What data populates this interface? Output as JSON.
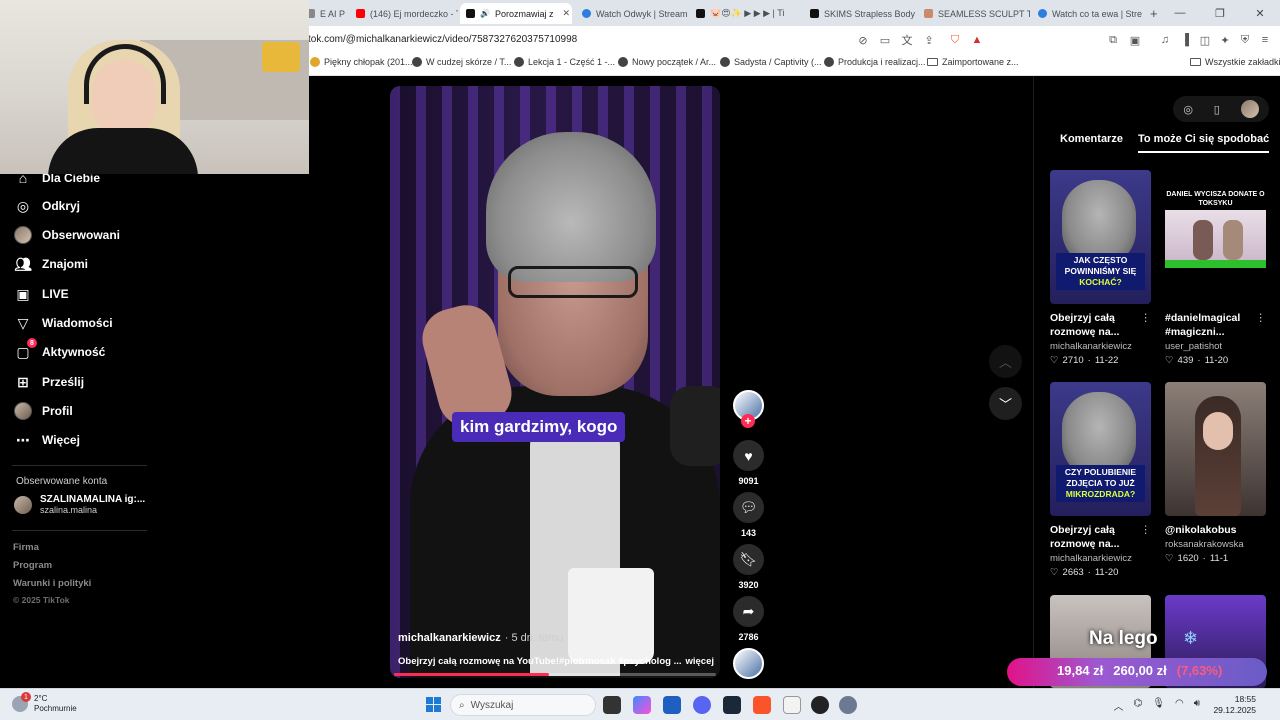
{
  "browser": {
    "tabs": [
      {
        "label": "E AI P",
        "favicon_color": "#888888"
      },
      {
        "label": "(146) Ej mordeczko - T",
        "favicon_color": "#ff0000"
      },
      {
        "label": "Porozmawiaj z",
        "favicon_color": "#111111",
        "active": true
      },
      {
        "label": "Watch Odwyk | Stream",
        "favicon_color": "#2f7de1"
      },
      {
        "label": "🐷😍✨ ▶ ▶ ▶ | Ti",
        "favicon_color": "#111111"
      },
      {
        "label": "SKIMS Strapless Body",
        "favicon_color": "#111111"
      },
      {
        "label": "SEAMLESS SCULPT TH",
        "favicon_color": "#c98b6b"
      },
      {
        "label": "Watch co ta ewa | Stre",
        "favicon_color": "#2f7de1"
      }
    ],
    "new_tab": "+",
    "url": "tok.com/@michalkanarkiewicz/video/7587327620375710998",
    "bookmarks": [
      "Piękny chłopak (201...",
      "W cudzej skórze / T...",
      "Lekcja 1 - Część 1 -...",
      "Nowy początek / Ar...",
      "Sadysta / Captivity (...",
      "Produkcja i realizacj...",
      "Zaimportowane z..."
    ],
    "all_bookmarks": "Wszystkie zakładki"
  },
  "sidebar": {
    "items": [
      {
        "label": "Dla Ciebie",
        "icon": "home-icon"
      },
      {
        "label": "Odkryj",
        "icon": "compass-icon"
      },
      {
        "label": "Obserwowani",
        "icon": "avatar-icon"
      },
      {
        "label": "Znajomi",
        "icon": "friends-icon"
      },
      {
        "label": "LIVE",
        "icon": "live-icon"
      },
      {
        "label": "Wiadomości",
        "icon": "send-icon"
      },
      {
        "label": "Aktywność",
        "icon": "activity-icon",
        "badge": "8"
      },
      {
        "label": "Prześlij",
        "icon": "upload-icon"
      },
      {
        "label": "Profil",
        "icon": "profile-icon"
      },
      {
        "label": "Więcej",
        "icon": "more-icon"
      }
    ],
    "followed_title": "Obserwowane konta",
    "followed": {
      "name": "SZALINAMALINA ig:...",
      "user": "szalina.malina"
    },
    "footer": [
      "Firma",
      "Program",
      "Warunki i polityki"
    ],
    "copyright": "© 2025 TikTok"
  },
  "video": {
    "caption": "kim gardzimy, kogo",
    "author": "michalkanarkiewicz",
    "age": "· 5 dn. temu",
    "description": "Obejrzyj całą rozmowę na YouTube!#piotrmosak #psycholog ...",
    "more": "więcej",
    "progress": 0.48,
    "likes": "9091",
    "comments": "143",
    "saves": "3920",
    "shares": "2786"
  },
  "right_panel": {
    "tabs": [
      "Komentarze",
      "To może Ci się spodobać"
    ],
    "cards": [
      {
        "title1": "Obejrzyj całą",
        "title2": "rozmowę na...",
        "user": "michalkanarkiewicz",
        "likes": "2710",
        "date": "11-22",
        "overlay": "JAK CZĘSTO POWINNIŚMY SIĘ",
        "overlay_hl": "KOCHAĆ?"
      },
      {
        "title1": "#danielmagical",
        "title2": "#magiczni...",
        "user": "user_patishot",
        "likes": "439",
        "date": "11-20",
        "overlay_top": "DANIEL WYCISZA DONATE O TOKSYKU"
      },
      {
        "title1": "Obejrzyj całą",
        "title2": "rozmowę na...",
        "user": "michalkanarkiewicz",
        "likes": "2663",
        "date": "11-20",
        "overlay": "CZY POLUBIENIE ZDJĘCIA TO JUŻ",
        "overlay_hl": "MIKROZDRADA?"
      },
      {
        "title1": "@nikolakobus",
        "title2": "",
        "user": "roksanakrakowska",
        "likes": "1620",
        "date": "11-1"
      }
    ]
  },
  "ad": {
    "headline": "Na lego",
    "new_price": "19,84 zł",
    "old_price": "260,00 zł",
    "discount": "(7,63%)"
  },
  "taskbar": {
    "temp": "2°C",
    "weather": "Pochmurnie",
    "weather_badge": "1",
    "search_placeholder": "Wyszukaj",
    "time": "18:55",
    "date": "29.12.2025"
  }
}
